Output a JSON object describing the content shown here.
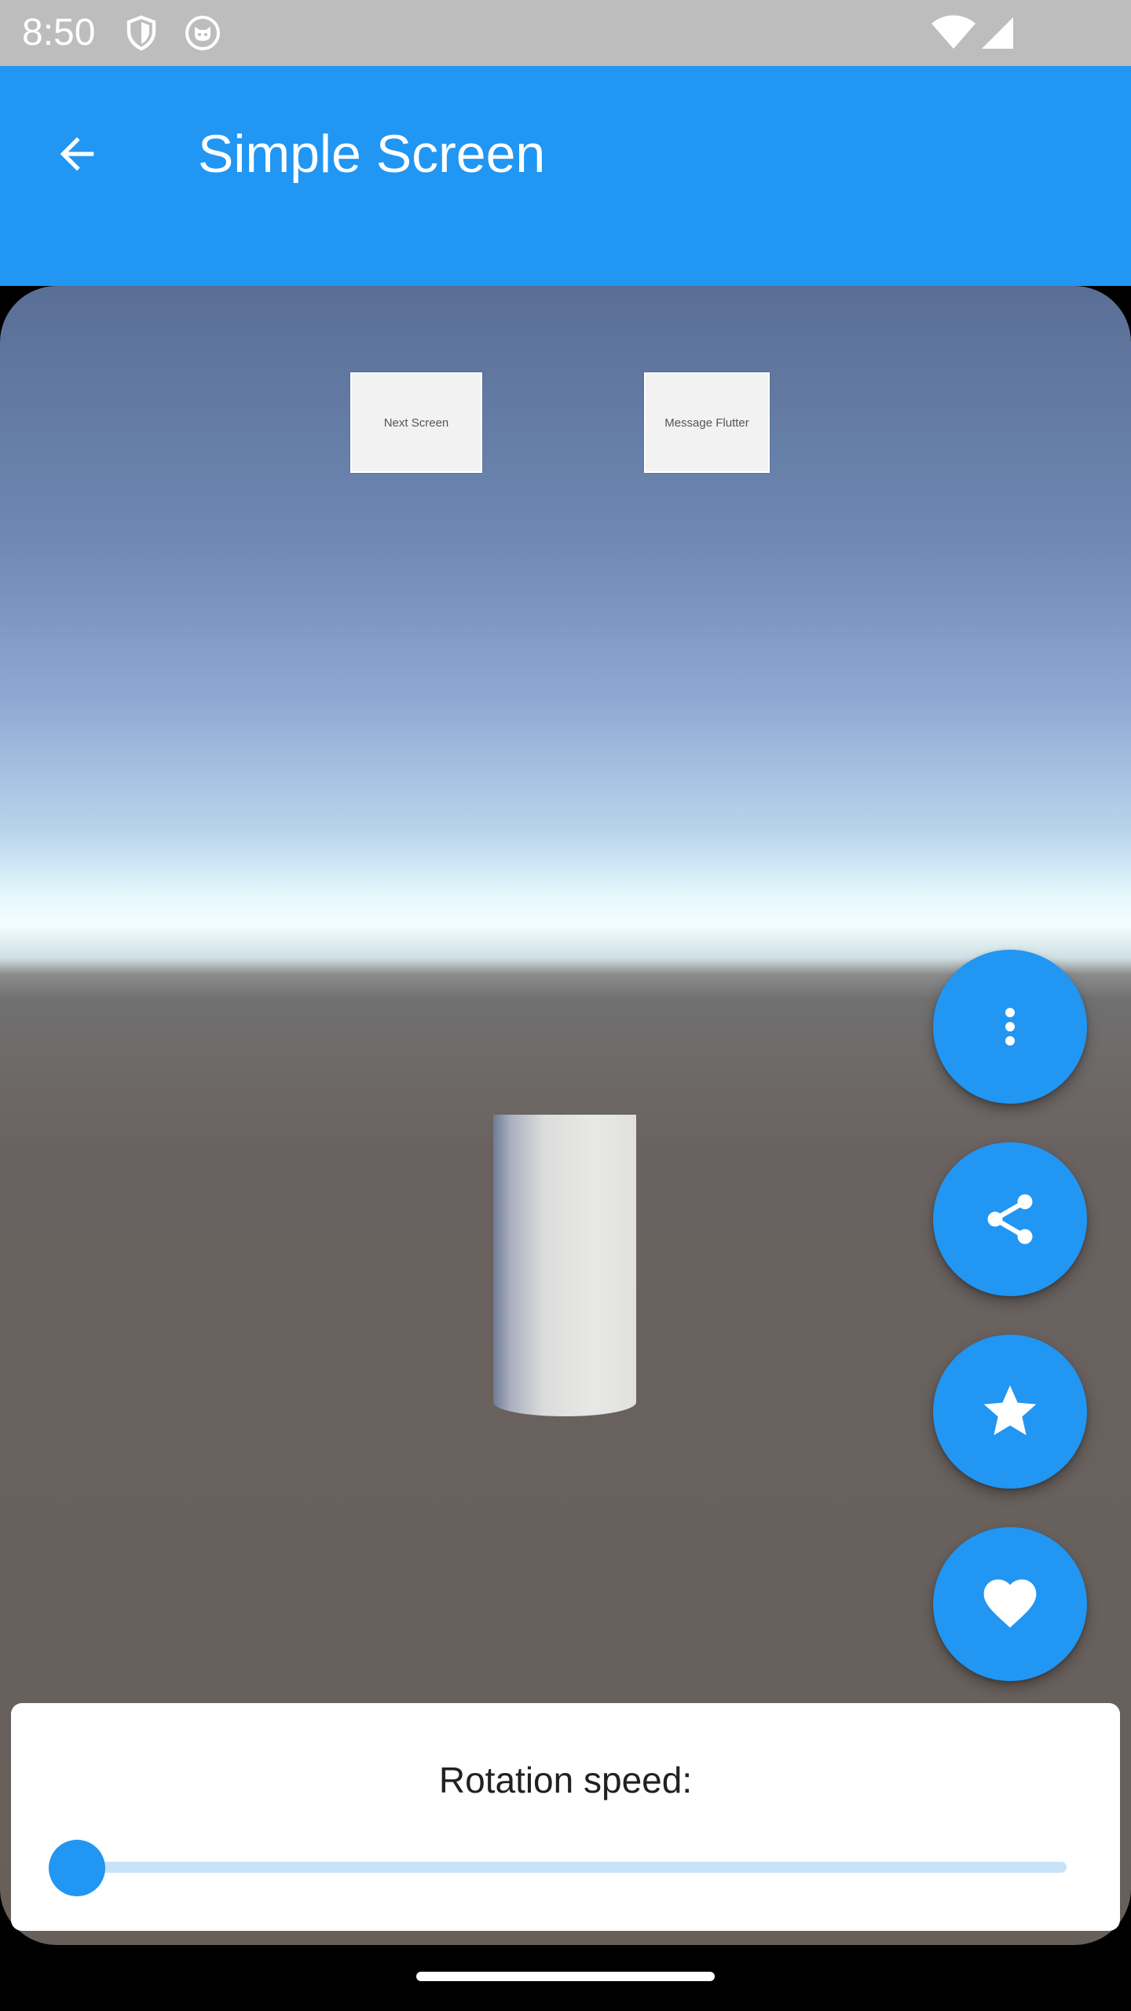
{
  "status_bar": {
    "time": "8:50",
    "icons": [
      "shield-icon",
      "cat-face-icon",
      "wifi-icon",
      "cell-signal-icon"
    ]
  },
  "app_bar": {
    "title": "Simple Screen",
    "back_icon": "arrow-left-icon",
    "background": "#2196f3"
  },
  "scene": {
    "buttons": [
      {
        "label": "Next Screen"
      },
      {
        "label": "Message Flutter"
      }
    ]
  },
  "fabs": [
    {
      "icon": "more-vertical-icon"
    },
    {
      "icon": "share-icon"
    },
    {
      "icon": "star-icon"
    },
    {
      "icon": "heart-icon"
    }
  ],
  "panel": {
    "label": "Rotation speed:",
    "slider_value": 0.0,
    "accent": "#2196f3"
  }
}
